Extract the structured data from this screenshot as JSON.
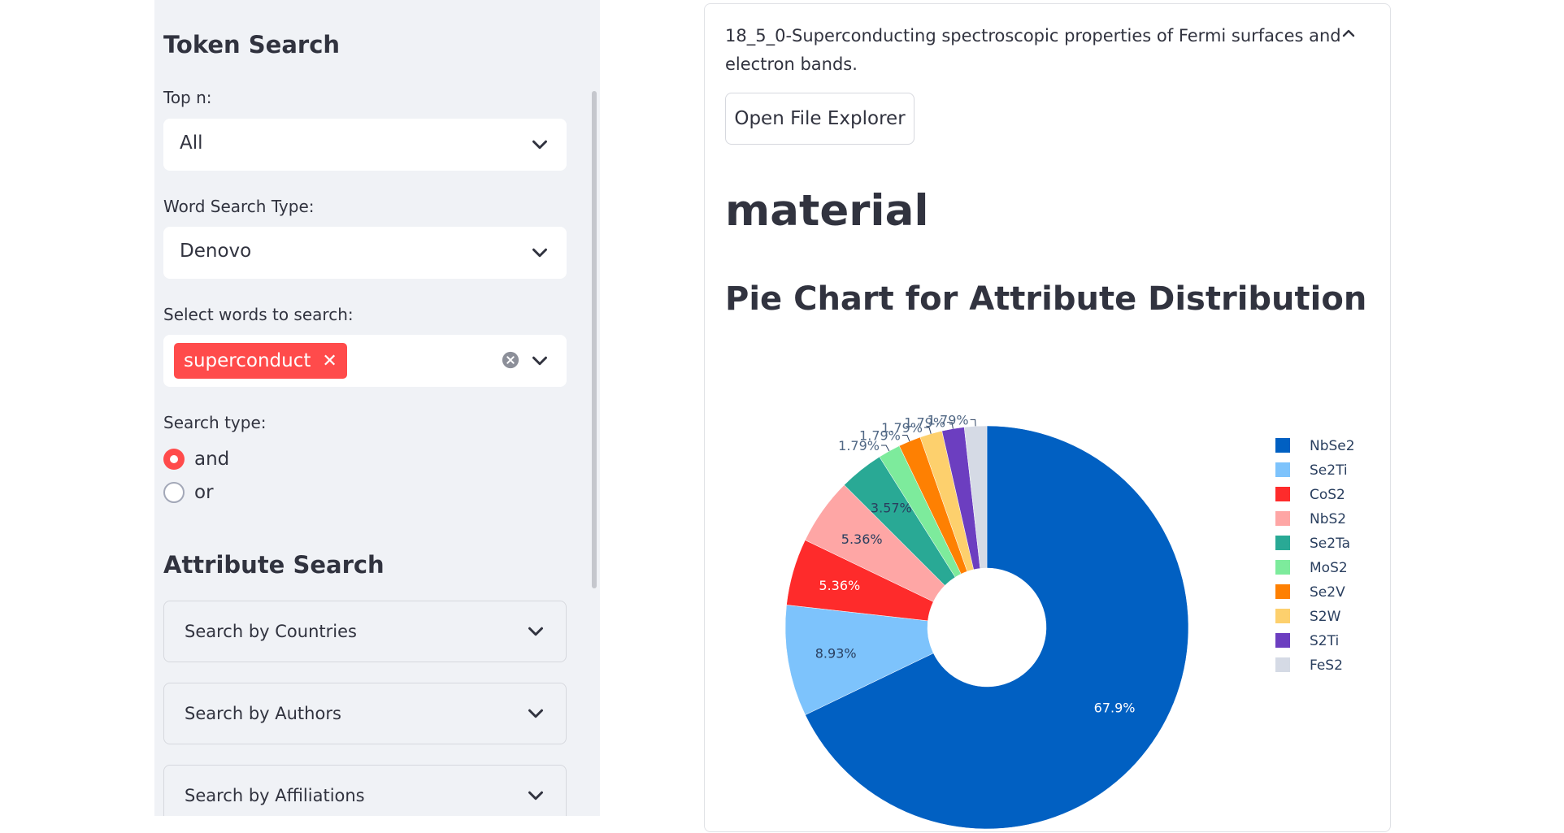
{
  "sidebar": {
    "token_search_title": "Token Search",
    "top_n": {
      "label": "Top n:",
      "value": "All"
    },
    "word_search_type": {
      "label": "Word Search Type:",
      "value": "Denovo"
    },
    "select_words": {
      "label": "Select words to search:",
      "tags": [
        "superconduct"
      ]
    },
    "search_type": {
      "label": "Search type:",
      "options": [
        "and",
        "or"
      ],
      "selected": "and"
    },
    "attribute_search_title": "Attribute Search",
    "expanders": [
      "Search by Countries",
      "Search by Authors",
      "Search by Affiliations"
    ]
  },
  "main": {
    "expander_title": "18_5_0-Superconducting spectroscopic properties of Fermi surfaces and electron bands.",
    "open_button": "Open File Explorer",
    "heading": "material",
    "subheading": "Pie Chart for Attribute Distribution"
  },
  "colors": {
    "accent": "#ff4b4b",
    "sidebar_bg": "#f0f2f6"
  },
  "chart_data": {
    "type": "pie",
    "hole": true,
    "labels": [
      "NbSe2",
      "Se2Ti",
      "CoS2",
      "NbS2",
      "Se2Ta",
      "MoS2",
      "Se2V",
      "S2W",
      "S2Ti",
      "FeS2"
    ],
    "values": [
      67.9,
      8.93,
      5.36,
      5.36,
      3.57,
      1.79,
      1.79,
      1.79,
      1.79,
      1.79
    ],
    "value_labels": [
      "67.9%",
      "8.93%",
      "5.36%",
      "5.36%",
      "3.57%",
      "1.79%",
      "1.79%",
      "1.79%",
      "1.79%",
      "1.79%"
    ],
    "colors": [
      "#0160c2",
      "#7dc3fc",
      "#fe2b2b",
      "#fea6a5",
      "#29a995",
      "#7deb9c",
      "#fe8002",
      "#fdd06d",
      "#6c3ec0",
      "#d5dae5"
    ],
    "legend_position": "right"
  }
}
